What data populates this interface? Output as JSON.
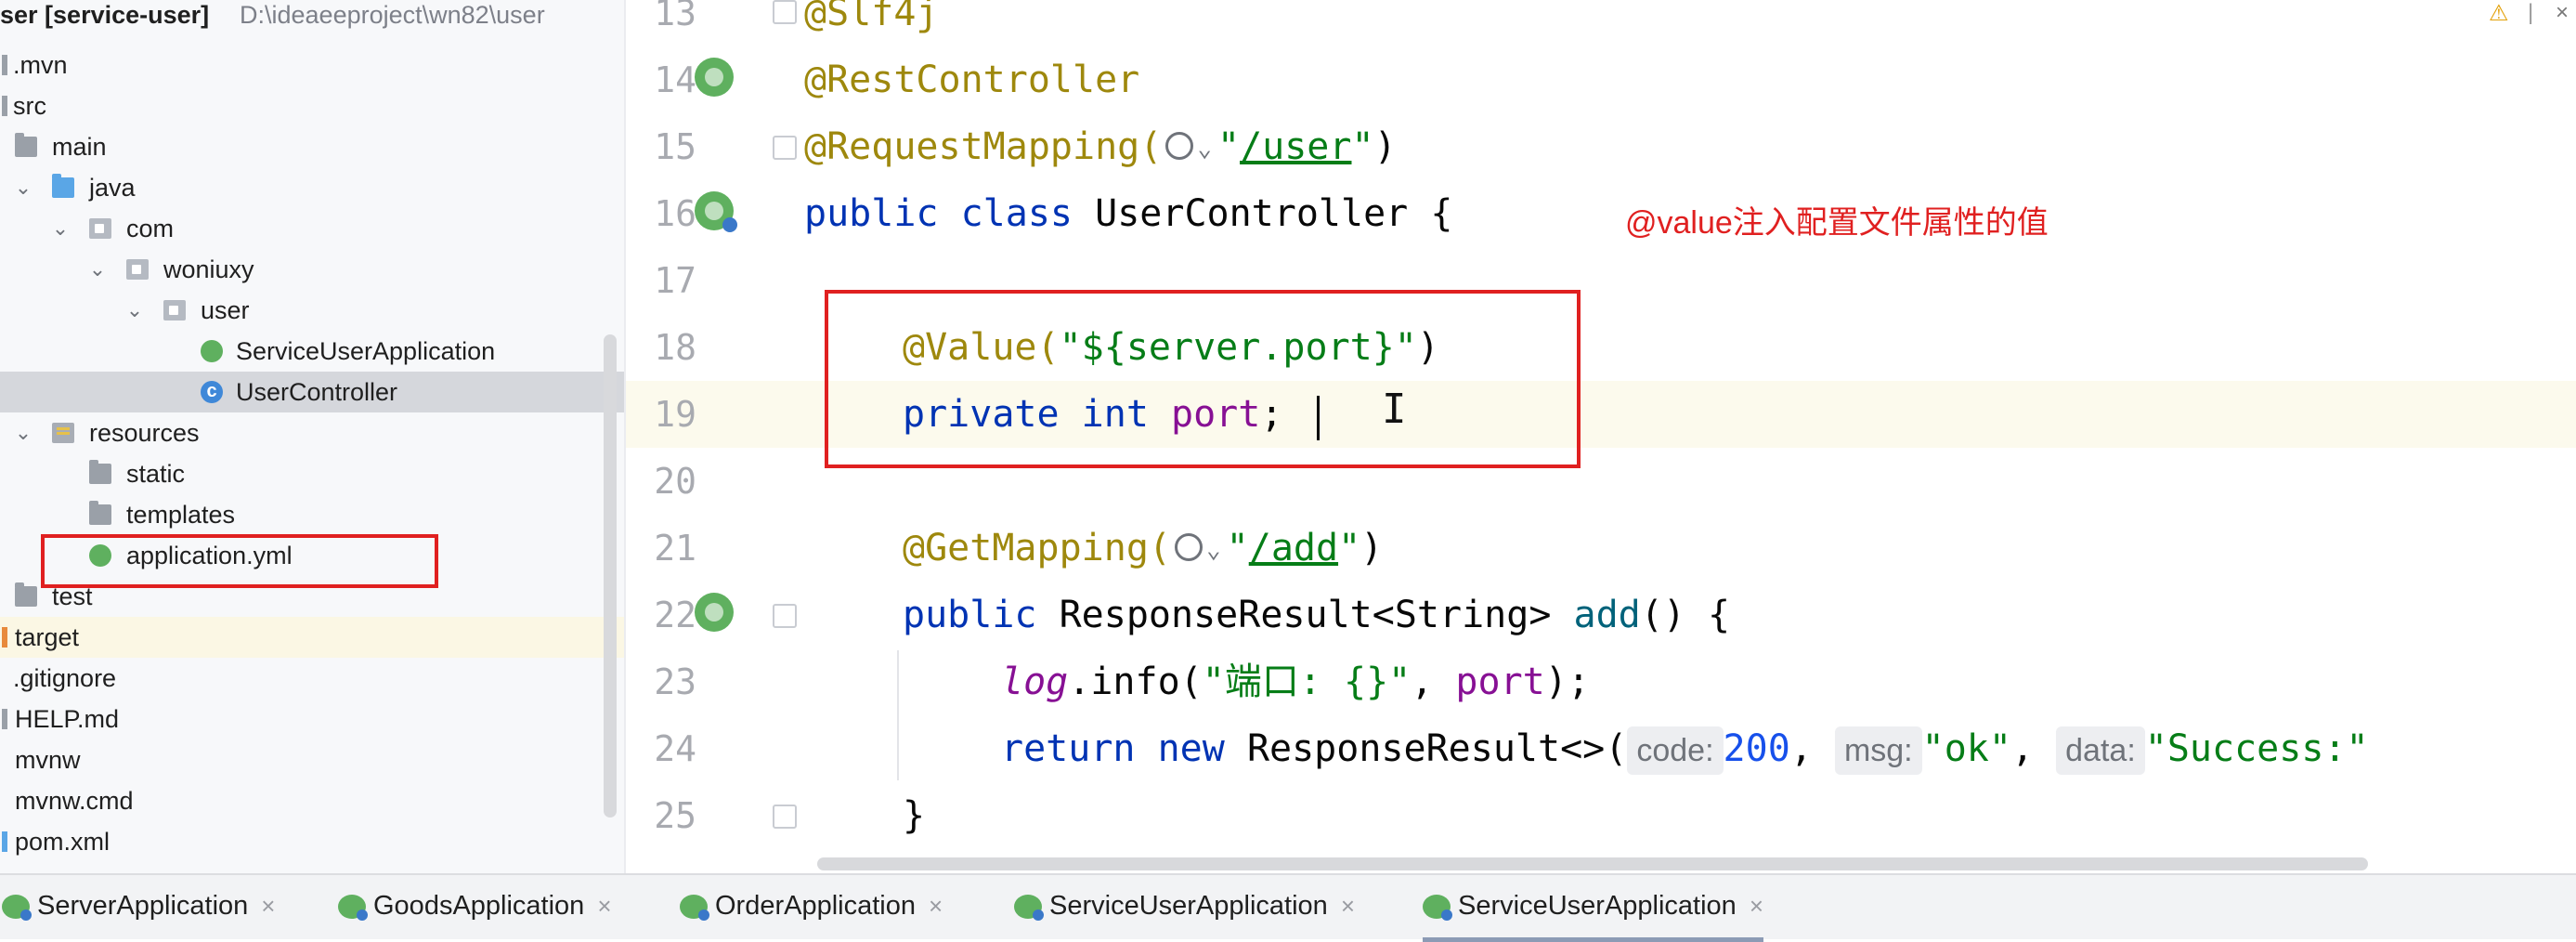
{
  "tree": {
    "project": {
      "name_prefix": "ser ",
      "module": "[service-user]",
      "path": "D:\\ideaeeproject\\wn82\\user"
    },
    "items": [
      {
        "label": ".mvn",
        "icon": "folder-icon"
      },
      {
        "label": "src",
        "icon": "folder-icon"
      },
      {
        "label": "main",
        "icon": "folder-icon"
      },
      {
        "label": "java",
        "icon": "source-folder-icon",
        "expanded": true
      },
      {
        "label": "com",
        "icon": "package-icon",
        "expanded": true
      },
      {
        "label": "woniuxy",
        "icon": "package-icon",
        "expanded": true
      },
      {
        "label": "user",
        "icon": "package-icon",
        "expanded": true
      },
      {
        "label": "ServiceUserApplication",
        "icon": "spring-boot-class-icon"
      },
      {
        "label": "UserController",
        "icon": "java-class-icon",
        "selected": true
      },
      {
        "label": "resources",
        "icon": "resources-folder-icon",
        "expanded": true
      },
      {
        "label": "static",
        "icon": "folder-icon"
      },
      {
        "label": "templates",
        "icon": "folder-icon"
      },
      {
        "label": "application.yml",
        "icon": "spring-yaml-icon"
      },
      {
        "label": "test",
        "icon": "folder-icon"
      },
      {
        "label": "target",
        "icon": "target-folder-icon"
      },
      {
        "label": ".gitignore",
        "icon": "file-icon"
      },
      {
        "label": "HELP.md",
        "icon": "file-icon"
      },
      {
        "label": "mvnw",
        "icon": "file-icon"
      },
      {
        "label": "mvnw.cmd",
        "icon": "file-icon"
      },
      {
        "label": "pom.xml",
        "icon": "file-icon"
      }
    ]
  },
  "editor": {
    "line_numbers": [
      "13",
      "14",
      "15",
      "16",
      "17",
      "18",
      "19",
      "20",
      "21",
      "22",
      "23",
      "24",
      "25"
    ],
    "l13": {
      "annot": "@Slf4j"
    },
    "l14": {
      "annot": "@RestController"
    },
    "l15": {
      "annot": "@RequestMapping(",
      "path": "/user",
      "close": ")"
    },
    "l16": {
      "kw1": "public",
      "kw2": "class",
      "name": "UserController",
      "brace": "{"
    },
    "l18": {
      "annot": "@Value(",
      "str": "\"${server.port}\"",
      "close": ")"
    },
    "l19": {
      "kw1": "private",
      "kw2": "int",
      "field": "port",
      "semi": ";"
    },
    "l21": {
      "annot": "@GetMapping(",
      "path": "/add",
      "close": ")"
    },
    "l22": {
      "kw": "public",
      "type": "ResponseResult<String>",
      "method": "add",
      "rest": "() {"
    },
    "l23": {
      "log": "log",
      "call": ".info(",
      "str": "\"端口: {}\"",
      "comma": ", ",
      "field": "port",
      "end": ");"
    },
    "l24": {
      "kw1": "return",
      "kw2": "new",
      "type": "ResponseResult<>(",
      "hint_code": "code:",
      "code": "200",
      "hint_msg": "msg:",
      "msg": "\"ok\"",
      "hint_data": "data:",
      "data": "\"Success:\""
    },
    "l25": {
      "brace": "}"
    }
  },
  "annotation": {
    "note": "@value注入配置文件属性的值",
    "color": "#e02020"
  },
  "run_tabs": [
    {
      "label": "ServerApplication"
    },
    {
      "label": "GoodsApplication"
    },
    {
      "label": "OrderApplication"
    },
    {
      "label": "ServiceUserApplication"
    },
    {
      "label": "ServiceUserApplication",
      "active": true
    }
  ],
  "close_glyph": "×",
  "quote": "\"",
  "globe_chevron": "⌄"
}
